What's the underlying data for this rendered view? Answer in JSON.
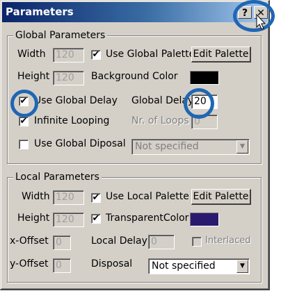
{
  "window": {
    "title": "Parameters",
    "help_glyph": "?",
    "close_glyph": "✕"
  },
  "global": {
    "legend": "Global Parameters",
    "width_label": "Width",
    "width_value": "120",
    "height_label": "Height",
    "height_value": "120",
    "use_palette_label": "Use Global Palette",
    "use_palette_checked": "✔",
    "edit_palette_label": "Edit Palette",
    "bg_color_label": "Background Color",
    "bg_color": "#000000",
    "use_delay_label": "Use Global Delay",
    "use_delay_checked": "✔",
    "delay_label": "Global Delay",
    "delay_value": "20",
    "infinite_label": "Infinite Looping",
    "infinite_checked": "✔",
    "loops_label": "Nr. of Loops",
    "loops_value": "0",
    "disposal_label": "Use Global Diposal",
    "disposal_checked": "",
    "disposal_value": "Not specified"
  },
  "local": {
    "legend": "Local Parameters",
    "width_label": "Width",
    "width_value": "120",
    "height_label": "Height",
    "height_value": "120",
    "use_palette_label": "Use Local Palette",
    "use_palette_checked": "✔",
    "edit_palette_label": "Edit Palette",
    "transparent_label": "TransparentColor",
    "transparent_checked": "✔",
    "transparent_color": "#2a1a6e",
    "xoffset_label": "x-Offset",
    "xoffset_value": "0",
    "yoffset_label": "y-Offset",
    "yoffset_value": "0",
    "delay_label": "Local Delay",
    "delay_value": "0",
    "interlaced_label": "Interlaced",
    "disposal_label": "Disposal",
    "disposal_value": "Not specified"
  },
  "icons": {
    "dropdown": "chevron-down-icon",
    "cursor": "arrow-cursor-icon"
  },
  "accent": "#1f66b5"
}
